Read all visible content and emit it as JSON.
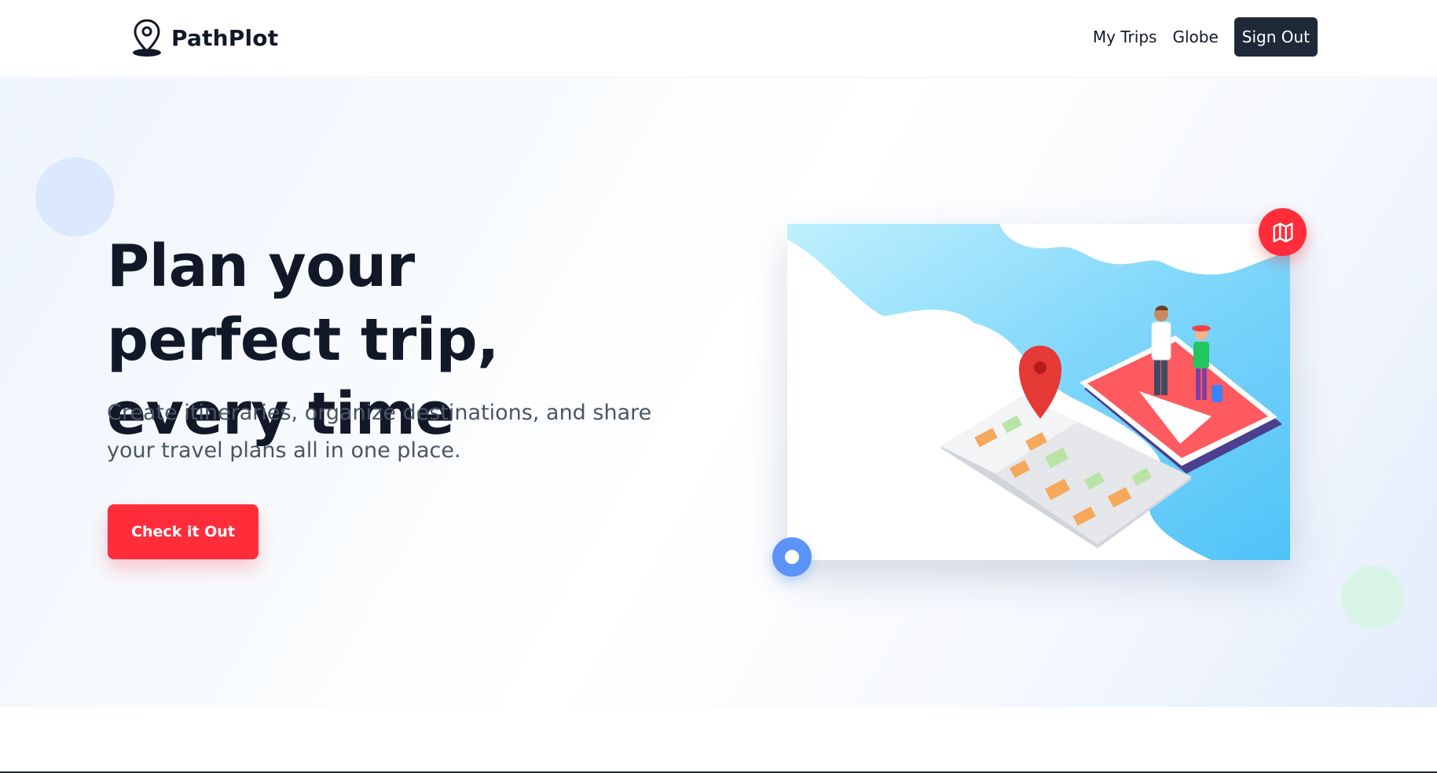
{
  "header": {
    "brand_name": "PathPlot",
    "logo_icon": "map-pin-icon",
    "nav": {
      "my_trips": "My Trips",
      "globe": "Globe",
      "sign_out": "Sign Out"
    }
  },
  "hero": {
    "title": "Plan your perfect trip, every time",
    "subtitle": "Create itineraries, organize destinations, and share your travel plans all in one place.",
    "cta_label": "Check it Out",
    "illustration": "travelers-on-phone-map-illustration",
    "badge_icon": "map-icon"
  },
  "colors": {
    "accent": "#ff2d3a",
    "dark": "#1f2937",
    "text": "#111827",
    "muted": "#4b5563",
    "blue": "#5b93f7",
    "sky": "#5ac8fa"
  }
}
